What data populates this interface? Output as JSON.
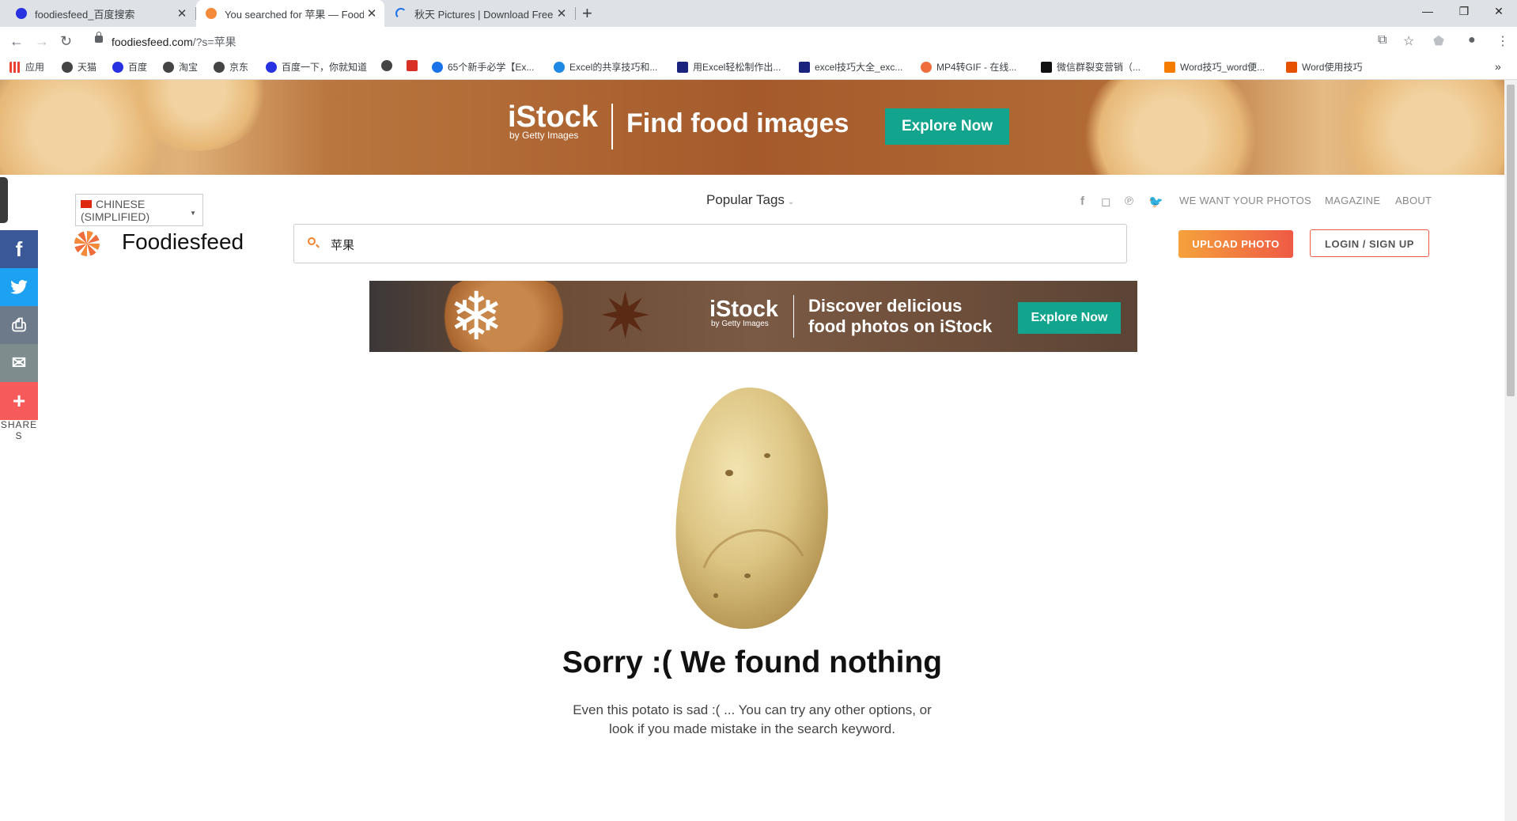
{
  "browser": {
    "tabs": [
      {
        "title": "foodiesfeed_百度搜索",
        "close": "✕"
      },
      {
        "title": "You searched for 苹果 — Food",
        "close": "✕"
      },
      {
        "title": "秋天 Pictures | Download Free",
        "close": "✕"
      }
    ],
    "new_tab": "+",
    "window": {
      "minimize": "—",
      "restore": "❐",
      "close": "✕"
    },
    "url_host": "foodiesfeed.com",
    "url_path": "/?s=苹果",
    "bookmarks": [
      {
        "label": "应用",
        "color": "#4285f4"
      },
      {
        "label": "天猫",
        "color": "#444444"
      },
      {
        "label": "百度",
        "color": "#2932e1"
      },
      {
        "label": "淘宝",
        "color": "#444444"
      },
      {
        "label": "京东",
        "color": "#444444"
      },
      {
        "label": "百度一下，你就知道",
        "color": "#2932e1"
      },
      {
        "label": "",
        "color": "#444444"
      },
      {
        "label": "",
        "color": "#d93025"
      },
      {
        "label": "65个新手必学【Ex...",
        "color": "#1a73e8"
      },
      {
        "label": "Excel的共享技巧和...",
        "color": "#1e88e5"
      },
      {
        "label": "用Excel轻松制作出...",
        "color": "#1a237e"
      },
      {
        "label": "excel技巧大全_exc...",
        "color": "#1a237e"
      },
      {
        "label": "MP4转GIF - 在线...",
        "color": "#ef6c3d"
      },
      {
        "label": "微信群裂变营销（...",
        "color": "#111111"
      },
      {
        "label": "Word技巧_word便...",
        "color": "#f57c00"
      },
      {
        "label": "Word使用技巧",
        "color": "#e65100"
      }
    ],
    "more_bookmarks": "»"
  },
  "top_banner": {
    "logo": "iStock",
    "logo_sub": "by Getty Images",
    "headline": "Find food images",
    "button": "Explore Now"
  },
  "share": {
    "items": [
      {
        "name": "facebook",
        "glyph": "f",
        "color": "#3b5998"
      },
      {
        "name": "twitter",
        "glyph": "t",
        "color": "#1da1f2"
      },
      {
        "name": "print",
        "glyph": "⎙",
        "color": "#6c7a89"
      },
      {
        "name": "email",
        "glyph": "✉",
        "color": "#7f8c8d"
      },
      {
        "name": "more",
        "glyph": "+",
        "color": "#f65a5b"
      }
    ],
    "label_line1": "SHARE",
    "label_line2": "S"
  },
  "header": {
    "language_line1": "CHINESE",
    "language_line2": "(SIMPLIFIED)",
    "site_name": "Foodiesfeed",
    "popular_tags": "Popular Tags",
    "nav": [
      "WE WANT YOUR PHOTOS",
      "MAGAZINE",
      "ABOUT"
    ],
    "search_value": "苹果",
    "upload": "UPLOAD PHOTO",
    "login": "LOGIN / SIGN UP"
  },
  "ad": {
    "logo": "iStock",
    "logo_sub": "by Getty Images",
    "line1": "Discover delicious",
    "line2": "food photos on iStock",
    "button": "Explore Now"
  },
  "result": {
    "title": "Sorry :( We found nothing",
    "line1": "Even this potato is sad :( ... You can try any other options, or",
    "line2": "look if you made mistake in the search keyword."
  }
}
